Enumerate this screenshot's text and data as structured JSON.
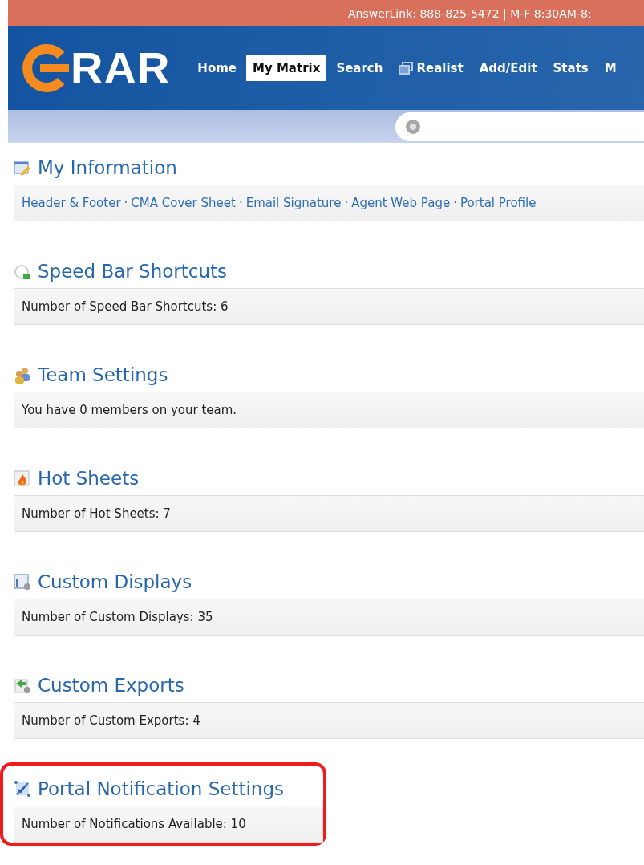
{
  "top_bar": {
    "text": "AnswerLink: 888-825-5472 | M-F 8:30AM-8:"
  },
  "logo": {
    "text": "RAR"
  },
  "nav": [
    {
      "label": "Home",
      "selected": false
    },
    {
      "label": "My Matrix",
      "selected": true
    },
    {
      "label": "Search",
      "selected": false
    },
    {
      "label": "Realist",
      "selected": false,
      "kind": "icon"
    },
    {
      "label": "Add/Edit",
      "selected": false
    },
    {
      "label": "Stats",
      "selected": false
    },
    {
      "label": "M",
      "selected": false
    }
  ],
  "sections": [
    {
      "title": "My Information",
      "kind": "edit",
      "highlighted": false,
      "separator": "·",
      "links": [
        "Header & Footer",
        "CMA Cover Sheet",
        "Email Signature",
        "Agent Web Page",
        "Portal Profile"
      ]
    },
    {
      "title": "Speed Bar Shortcuts",
      "kind": "shortcut",
      "highlighted": false,
      "text": "Number of Speed Bar Shortcuts: 6"
    },
    {
      "title": "Team Settings",
      "kind": "team",
      "highlighted": false,
      "text": "You have 0 members on your team."
    },
    {
      "title": "Hot Sheets",
      "kind": "fire",
      "highlighted": false,
      "text": "Number of Hot Sheets: 7"
    },
    {
      "title": "Custom Displays",
      "kind": "display",
      "highlighted": false,
      "text": "Number of Custom Displays: 35"
    },
    {
      "title": "Custom Exports",
      "kind": "export",
      "highlighted": false,
      "text": "Number of Custom Exports: 4"
    },
    {
      "title": "Portal Notification Settings",
      "kind": "notify",
      "highlighted": true,
      "text": "Number of Notifications Available: 10"
    }
  ]
}
